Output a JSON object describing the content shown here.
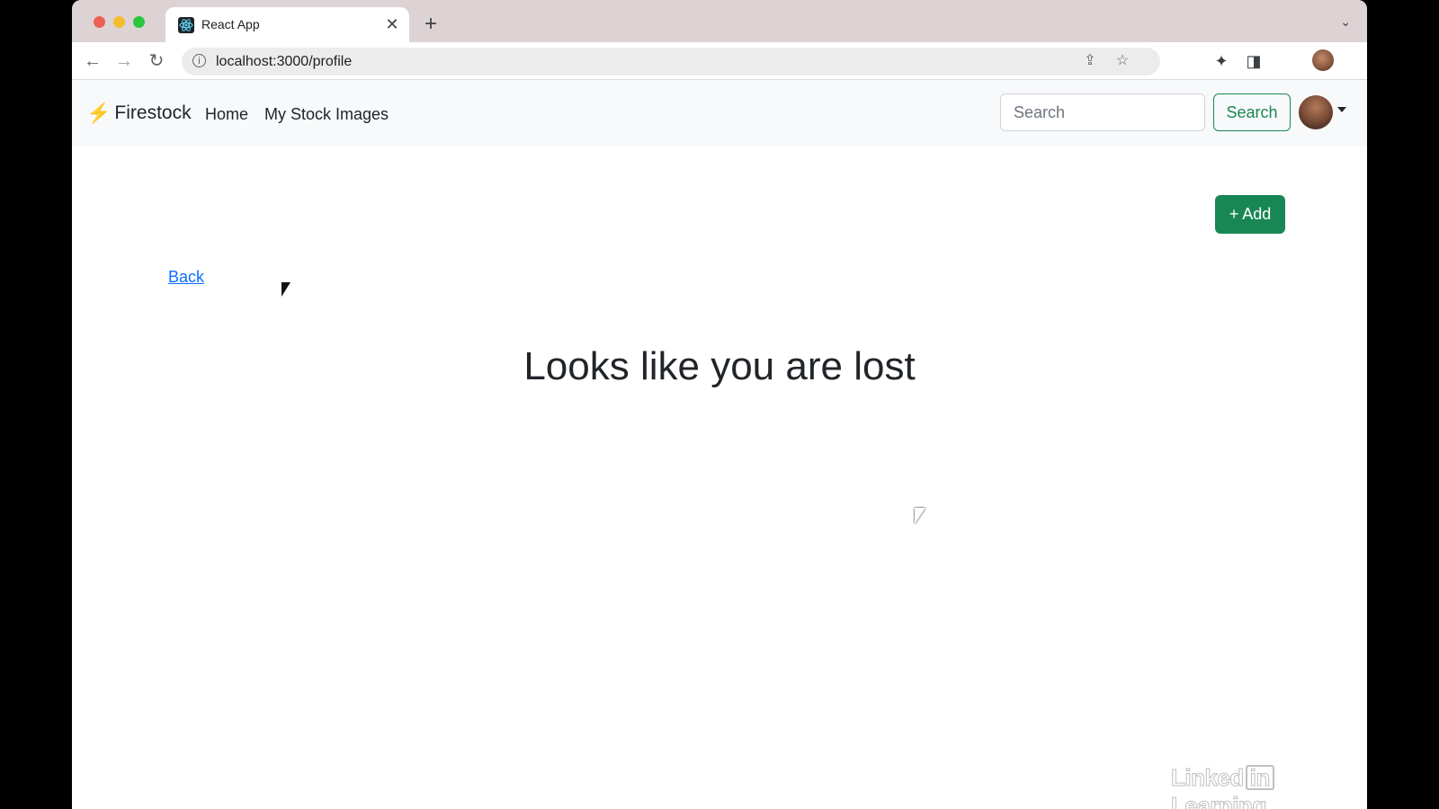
{
  "browser": {
    "tab": {
      "title": "React App",
      "favicon": "react-icon"
    },
    "url": "localhost:3000/profile",
    "icons": [
      "back-arrow-icon",
      "forward-arrow-icon",
      "reload-icon",
      "info-icon",
      "share-icon",
      "star-icon",
      "extensions-icon",
      "sidepanel-icon",
      "menu-icon"
    ]
  },
  "navbar": {
    "brand": "Firestock",
    "links": [
      "Home",
      "My Stock Images"
    ],
    "search_placeholder": "Search",
    "search_button": "Search"
  },
  "page": {
    "add_button": "+ Add",
    "back_link": "Back",
    "heading": "Looks like you are lost"
  },
  "watermark": {
    "part1": "Linked",
    "part2": "in",
    "part3": "Learning"
  },
  "colors": {
    "success": "#198754",
    "link": "#0d6efd",
    "navbar_bg": "#f8f9fa",
    "tabstrip_bg": "#ded3d4"
  }
}
